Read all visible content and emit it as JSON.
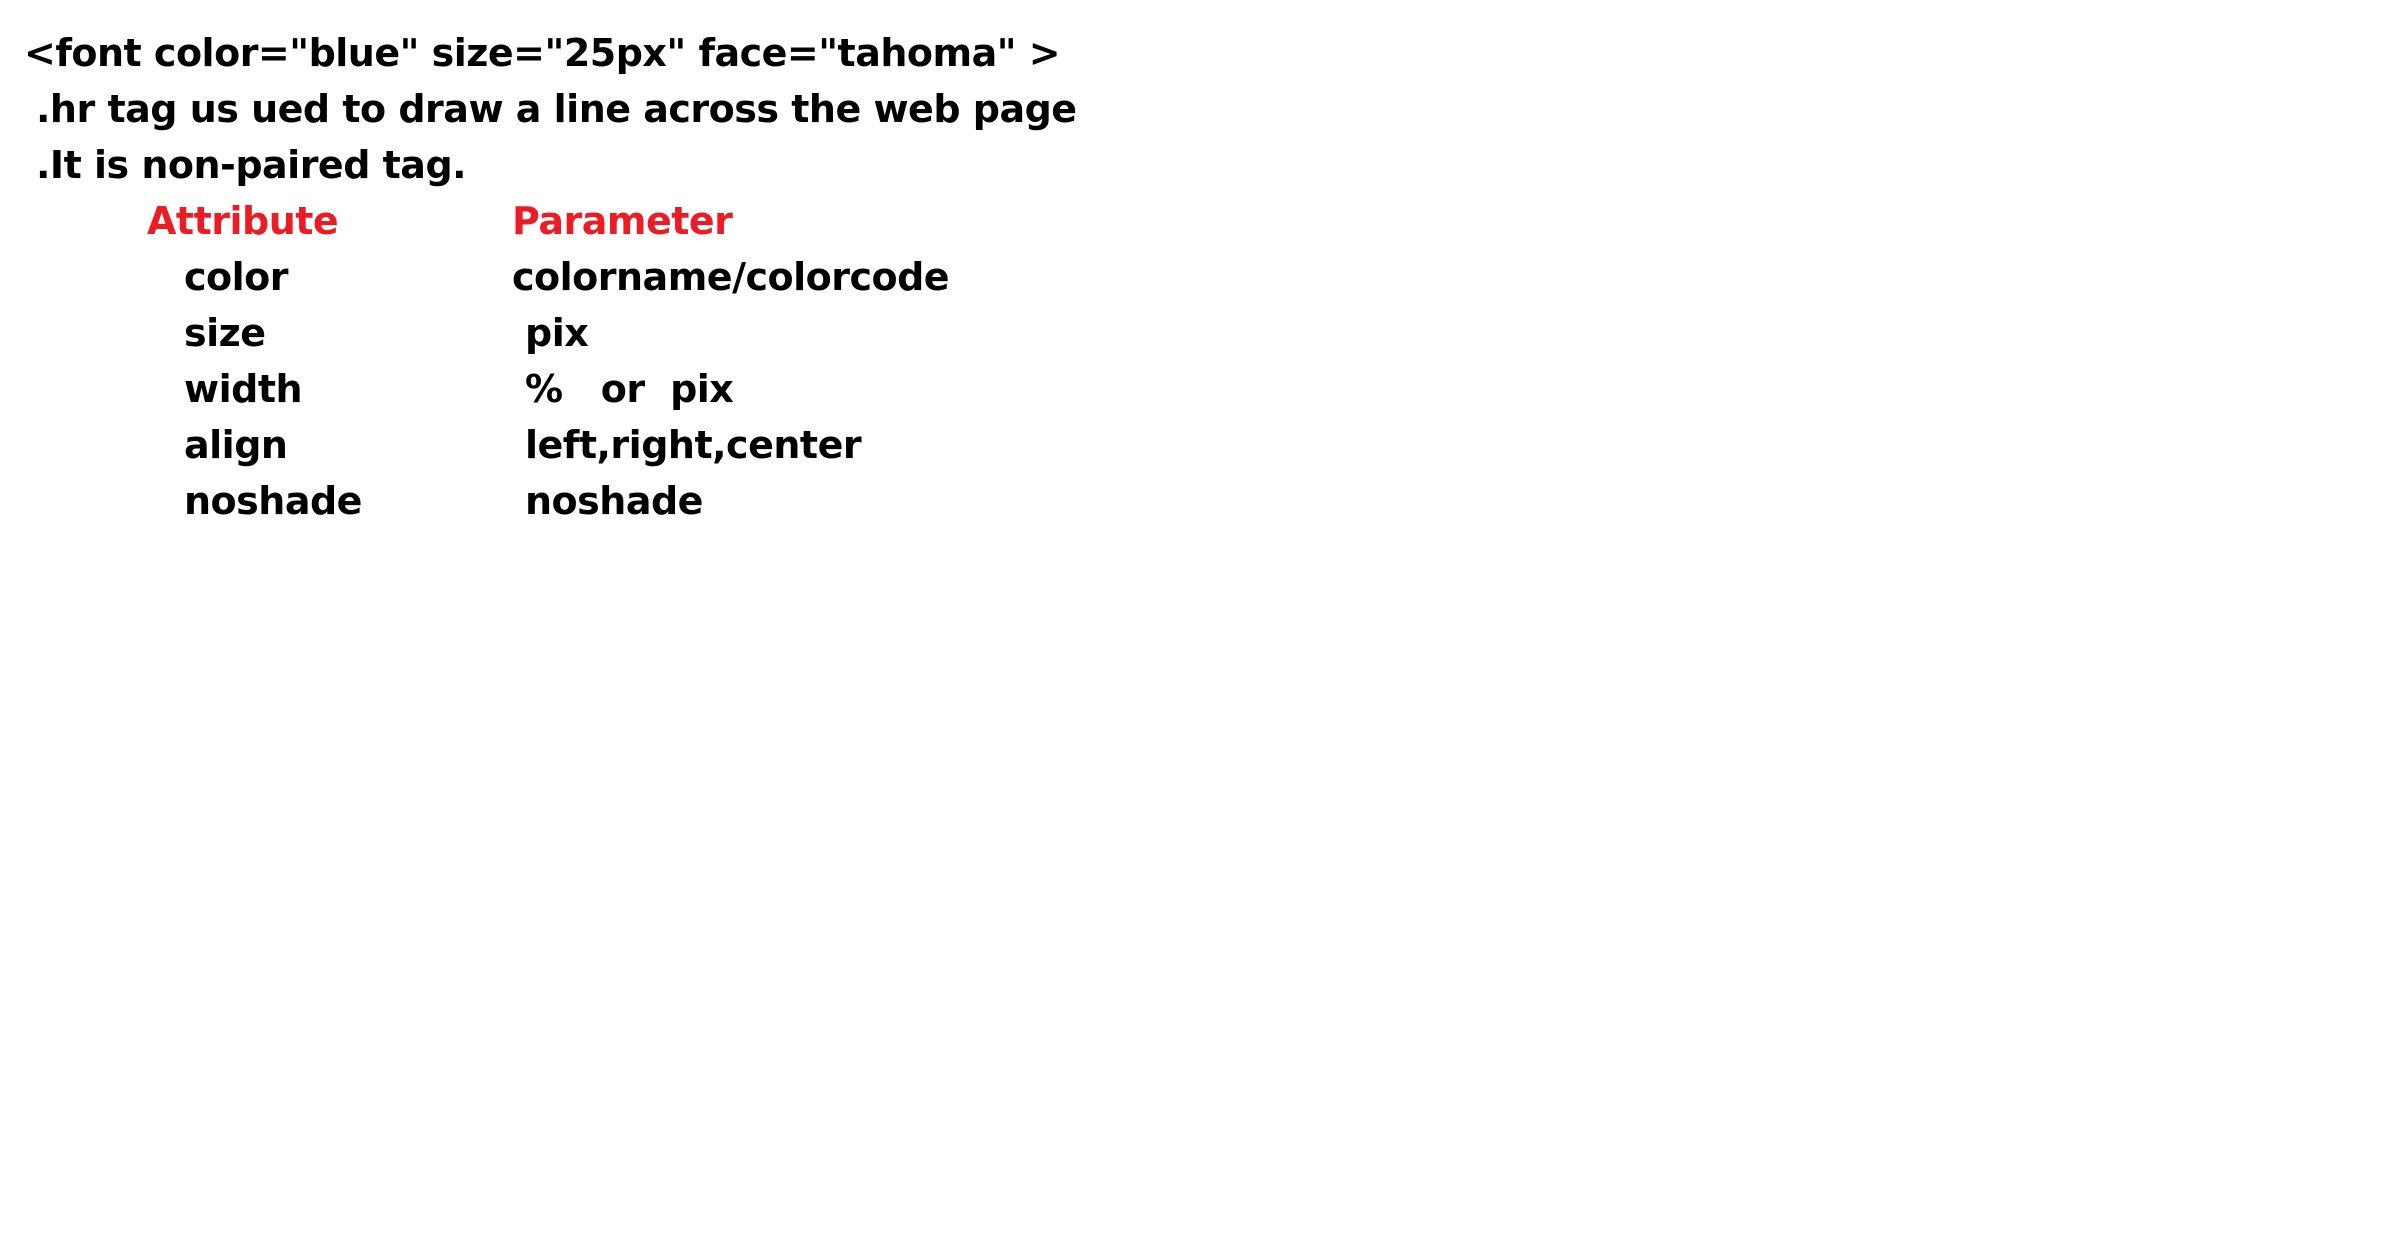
{
  "document": {
    "code_line": "<font color=\"blue\" size=\"25px\" face=\"tahoma\" >",
    "lines": [
      ".hr tag us ued to draw a line across the web page",
      ".It is non-paired tag."
    ],
    "table": {
      "header": {
        "attribute": "Attribute",
        "parameter": "Parameter"
      },
      "header_color": "#ed1c24",
      "rows": [
        {
          "attribute": "color",
          "parameter": "colorname/colorcode"
        },
        {
          "attribute": "size",
          "parameter": "pix"
        },
        {
          "attribute": "width",
          "parameter": "%   or  pix"
        },
        {
          "attribute": "align",
          "parameter": "left,right,center"
        },
        {
          "attribute": "noshade",
          "parameter": "noshade"
        }
      ]
    }
  }
}
